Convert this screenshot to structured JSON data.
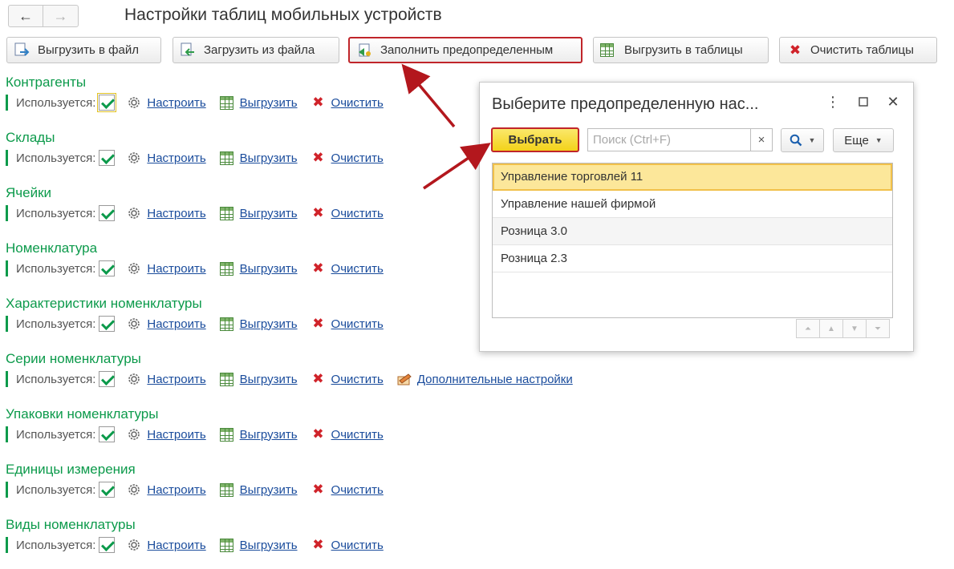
{
  "nav": {
    "back_icon": "←",
    "forward_icon": "→"
  },
  "page_title": "Настройки таблиц мобильных устройств",
  "toolbar": {
    "export_file": "Выгрузить в файл",
    "import_file": "Загрузить из файла",
    "fill_predefined": "Заполнить предопределенным",
    "export_tables": "Выгрузить в таблицы",
    "clear_tables": "Очистить таблицы"
  },
  "common": {
    "used_label": "Используется:",
    "configure": "Настроить",
    "export": "Выгрузить",
    "clear": "Очистить"
  },
  "sections": [
    {
      "title": "Контрагенты",
      "used": true
    },
    {
      "title": "Склады",
      "used": true
    },
    {
      "title": "Ячейки",
      "used": true
    },
    {
      "title": "Номенклатура",
      "used": true
    },
    {
      "title": "Характеристики номенклатуры",
      "used": true
    },
    {
      "title": "Серии номенклатуры",
      "used": true,
      "extra_link": "Дополнительные настройки"
    },
    {
      "title": "Упаковки номенклатуры",
      "used": true
    },
    {
      "title": "Единицы измерения",
      "used": true
    },
    {
      "title": "Виды номенклатуры",
      "used": true
    }
  ],
  "dialog": {
    "title": "Выберите предопределенную нас...",
    "choose_button": "Выбрать",
    "search_placeholder": "Поиск (Ctrl+F)",
    "search_value": "",
    "clear_search": "×",
    "more_button": "Еще",
    "items": [
      "Управление торговлей 11",
      "Управление нашей фирмой",
      "Розница 3.0",
      "Розница 2.3"
    ],
    "selected_index": 0
  },
  "colors": {
    "section_title": "#0c9a4b",
    "link": "#1a4c9c",
    "highlight": "#c0252a",
    "choose_button": "#f3d21a"
  }
}
